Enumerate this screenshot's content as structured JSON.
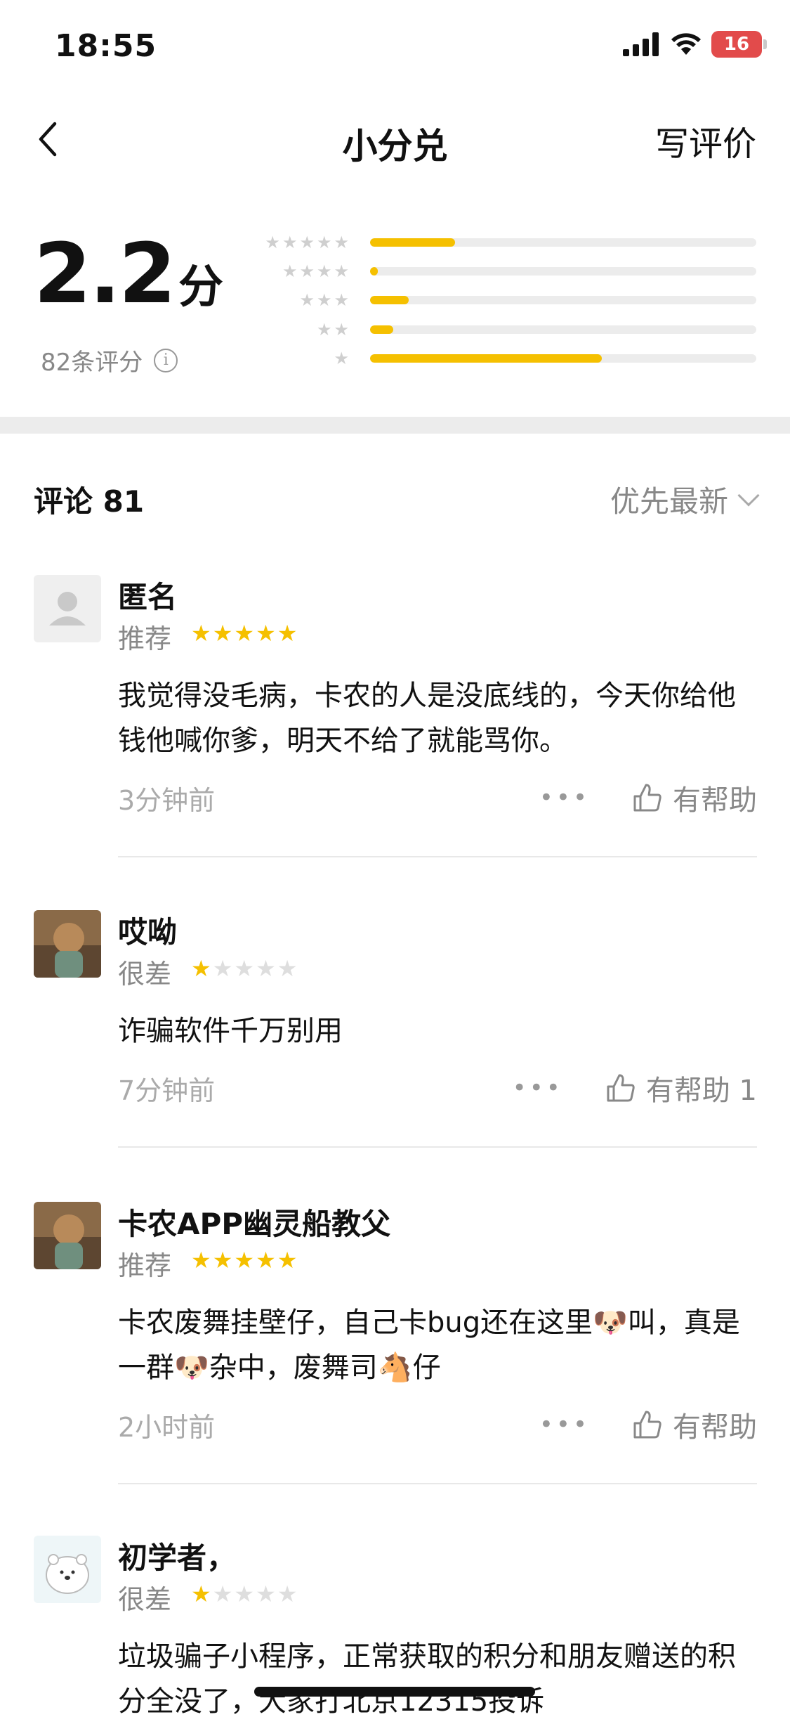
{
  "status_bar": {
    "time": "18:55",
    "battery": "16"
  },
  "header": {
    "title": "小分兑",
    "write_review": "写评价"
  },
  "rating": {
    "score": "2.2",
    "unit": "分",
    "count_text": "82条评分",
    "distribution": [
      {
        "stars": 5,
        "fraction": 0.22
      },
      {
        "stars": 4,
        "fraction": 0.02
      },
      {
        "stars": 3,
        "fraction": 0.1
      },
      {
        "stars": 2,
        "fraction": 0.06
      },
      {
        "stars": 1,
        "fraction": 0.6
      }
    ],
    "accent": "#f5c000"
  },
  "comments": {
    "title": "评论 81",
    "sort": "优先最新",
    "items": [
      {
        "name": "匿名",
        "verdict": "推荐",
        "stars": 5,
        "text": "我觉得没毛病，卡农的人是没底线的，今天你给他钱他喊你爹，明天不给了就能骂你。",
        "time": "3分钟前",
        "helpful": "有帮助",
        "avatar": "default-avatar"
      },
      {
        "name": "哎呦",
        "verdict": "很差",
        "stars": 1,
        "text": "诈骗软件千万别用",
        "time": "7分钟前",
        "helpful": "有帮助 1",
        "avatar": "photo-avatar"
      },
      {
        "name": "卡农APP幽灵船教父",
        "verdict": "推荐",
        "stars": 5,
        "text": "卡农废舞挂壁仔，自己卡bug还在这里🐶叫，真是一群🐶杂中，废舞司🐴仔",
        "time": "2小时前",
        "helpful": "有帮助",
        "avatar": "photo-avatar"
      },
      {
        "name": "初学者，",
        "verdict": "很差",
        "stars": 1,
        "text": "垃圾骗子小程序，正常获取的积分和朋友赠送的积分全没了，大家打北京12315投诉",
        "time": "",
        "helpful": "",
        "avatar": "bear-avatar"
      }
    ]
  }
}
